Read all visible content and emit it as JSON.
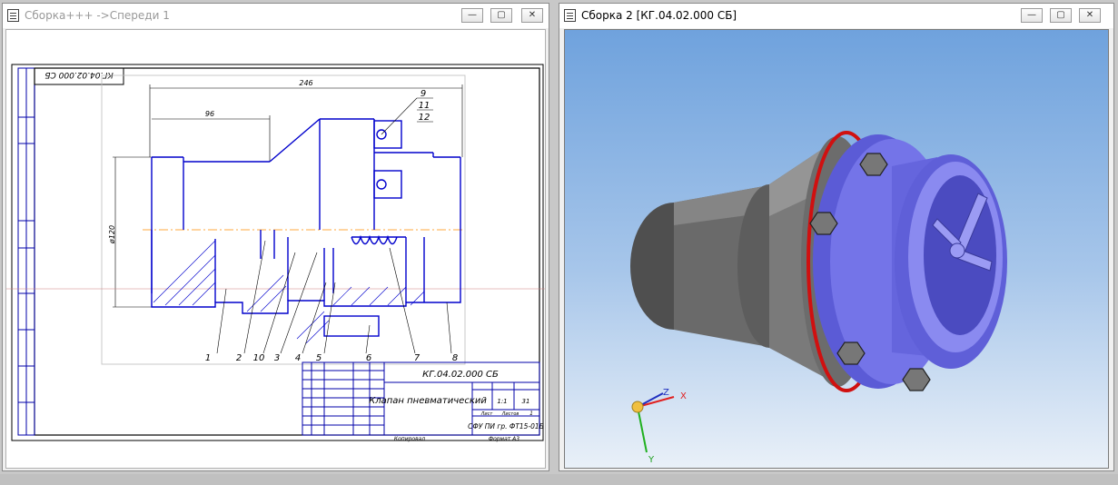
{
  "left_window": {
    "title": "Сборка+++ ->Спереди 1",
    "buttons": {
      "minimize": "—",
      "maximize": "▢",
      "close": "✕"
    }
  },
  "right_window": {
    "title": "Сборка 2 [КГ.04.02.000 СБ]",
    "buttons": {
      "minimize": "—",
      "maximize": "▢",
      "close": "✕"
    }
  },
  "drawing": {
    "stamp_code_rotated": "КГ.04.02.000 СБ",
    "dim_overall": "246",
    "dim_partial": "96",
    "dim_diameter": "ø120",
    "callouts_top": [
      "9",
      "11",
      "12"
    ],
    "callouts_bottom": [
      "1",
      "2",
      "10",
      "3",
      "4",
      "5",
      "6",
      "7",
      "8"
    ],
    "title_block": {
      "code": "КГ.04.02.000 СБ",
      "name": "Клапан пневматический",
      "scale": "1:1",
      "sheet_label": "Лист",
      "sheets_label": "Листов",
      "sheets": "1",
      "mass": "31",
      "organization": "СФУ ПИ гр. ФТ15-01Б",
      "copied": "Копировал",
      "format": "Формат А3"
    }
  },
  "viewport": {
    "axis_x": "X",
    "axis_y": "Y",
    "axis_z": "Z"
  }
}
